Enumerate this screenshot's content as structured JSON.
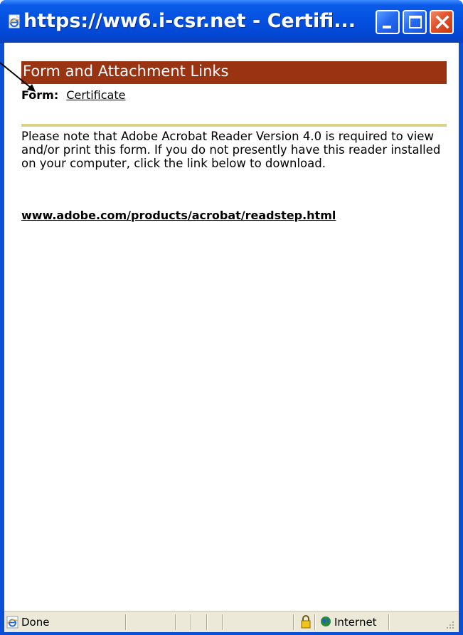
{
  "window": {
    "title": "https://ww6.i-csr.net - Certifi...",
    "title_icon": "ie-page-icon",
    "controls": [
      "minimize-icon",
      "maximize-icon",
      "close-icon"
    ]
  },
  "content": {
    "header_title": "Form and Attachment Links",
    "header_color": "#993311",
    "form_label": "Form:",
    "form_link": "Certificate",
    "divider_color": "#d9d38a",
    "note_text": "Please note that Adobe Acrobat Reader Version 4.0 is required to view and/or print this form. If you do not presently have this reader installed on your computer, click the link below to download.",
    "adobe_link": "www.adobe.com/products/acrobat/readstep.html"
  },
  "statusbar": {
    "status_text": "Done",
    "lock_icon": "padlock-icon",
    "zone_icon": "globe-icon",
    "zone_text": "Internet"
  }
}
